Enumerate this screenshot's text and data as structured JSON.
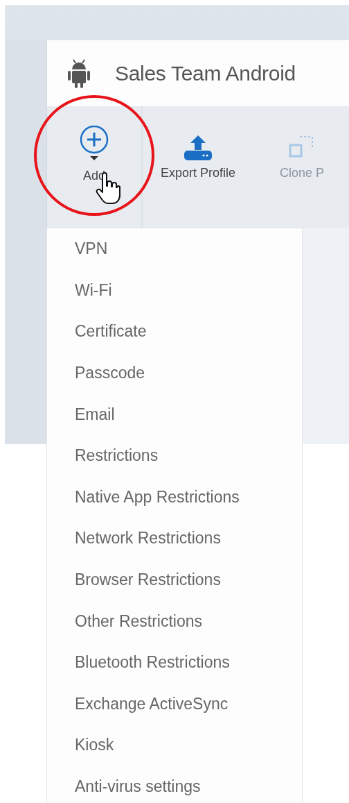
{
  "window": {
    "title": "Sales Team Android"
  },
  "toolbar": [
    {
      "label": "Add",
      "kind": "add",
      "disabled": false
    },
    {
      "label": "Export Profile",
      "kind": "export",
      "disabled": false
    },
    {
      "label": "Clone P",
      "kind": "clone",
      "disabled": true
    }
  ],
  "menu": {
    "items": [
      "VPN",
      "Wi-Fi",
      "Certificate",
      "Passcode",
      "Email",
      "Restrictions",
      "Native App Restrictions",
      "Network Restrictions",
      "Browser Restrictions",
      "Other Restrictions",
      "Bluetooth Restrictions",
      "Exchange ActiveSync",
      "Kiosk",
      "Anti-virus settings"
    ]
  }
}
